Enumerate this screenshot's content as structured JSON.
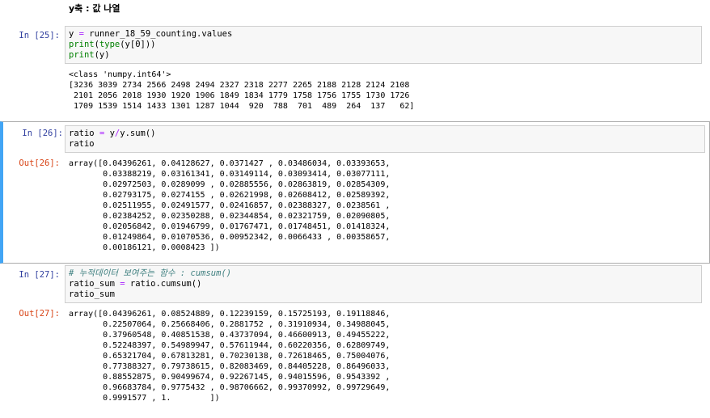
{
  "heading": "y축 : 값 나열",
  "cells": [
    {
      "in_prompt": "In [25]:",
      "code_lines": [
        [
          {
            "t": "y ",
            "c": ""
          },
          {
            "t": "=",
            "c": "op"
          },
          {
            "t": " runner_18_59_counting.values",
            "c": ""
          }
        ],
        [
          {
            "t": "print",
            "c": "kw"
          },
          {
            "t": "(",
            "c": ""
          },
          {
            "t": "type",
            "c": "kw"
          },
          {
            "t": "(y[0]))",
            "c": ""
          }
        ],
        [
          {
            "t": "print",
            "c": "kw"
          },
          {
            "t": "(y)",
            "c": ""
          }
        ]
      ],
      "stdout": "<class 'numpy.int64'>\n[3236 3039 2734 2566 2498 2494 2327 2318 2277 2265 2188 2128 2124 2108\n 2101 2056 2018 1930 1920 1906 1849 1834 1779 1758 1756 1755 1730 1726\n 1709 1539 1514 1433 1301 1287 1044  920  788  701  489  264  137   62]"
    },
    {
      "in_prompt": "In [26]:",
      "code_lines": [
        [
          {
            "t": "ratio ",
            "c": ""
          },
          {
            "t": "=",
            "c": "op"
          },
          {
            "t": " y",
            "c": ""
          },
          {
            "t": "/",
            "c": "op"
          },
          {
            "t": "y.sum()",
            "c": ""
          }
        ],
        [
          {
            "t": "ratio",
            "c": ""
          }
        ]
      ],
      "out_prompt": "Out[26]:",
      "output": "array([0.04396261, 0.04128627, 0.0371427 , 0.03486034, 0.03393653,\n       0.03388219, 0.03161341, 0.03149114, 0.03093414, 0.03077111,\n       0.02972503, 0.0289099 , 0.02885556, 0.02863819, 0.02854309,\n       0.02793175, 0.0274155 , 0.02621998, 0.02608412, 0.02589392,\n       0.02511955, 0.02491577, 0.02416857, 0.02388327, 0.0238561 ,\n       0.02384252, 0.02350288, 0.02344854, 0.02321759, 0.02090805,\n       0.02056842, 0.01946799, 0.01767471, 0.01748451, 0.01418324,\n       0.01249864, 0.01070536, 0.00952342, 0.0066433 , 0.00358657,\n       0.00186121, 0.0008423 ])"
    },
    {
      "in_prompt": "In [27]:",
      "code_lines": [
        [
          {
            "t": "# 누적데이터 보여주는 함수 : cumsum()",
            "c": "cm"
          }
        ],
        [
          {
            "t": "ratio_sum ",
            "c": ""
          },
          {
            "t": "=",
            "c": "op"
          },
          {
            "t": " ratio.cumsum()",
            "c": ""
          }
        ],
        [
          {
            "t": "ratio_sum",
            "c": ""
          }
        ]
      ],
      "out_prompt": "Out[27]:",
      "output": "array([0.04396261, 0.08524889, 0.12239159, 0.15725193, 0.19118846,\n       0.22507064, 0.25668406, 0.2881752 , 0.31910934, 0.34988045,\n       0.37960548, 0.40851538, 0.43737094, 0.46600913, 0.49455222,\n       0.52248397, 0.54989947, 0.57611944, 0.60220356, 0.62809749,\n       0.65321704, 0.67813281, 0.70230138, 0.72618465, 0.75004076,\n       0.77388327, 0.79738615, 0.82083469, 0.84405228, 0.86496033,\n       0.88552875, 0.90499674, 0.92267145, 0.94015596, 0.9543392 ,\n       0.96683784, 0.9775432 , 0.98706662, 0.99370992, 0.99729649,\n       0.9991577 , 1.        ])"
    }
  ]
}
